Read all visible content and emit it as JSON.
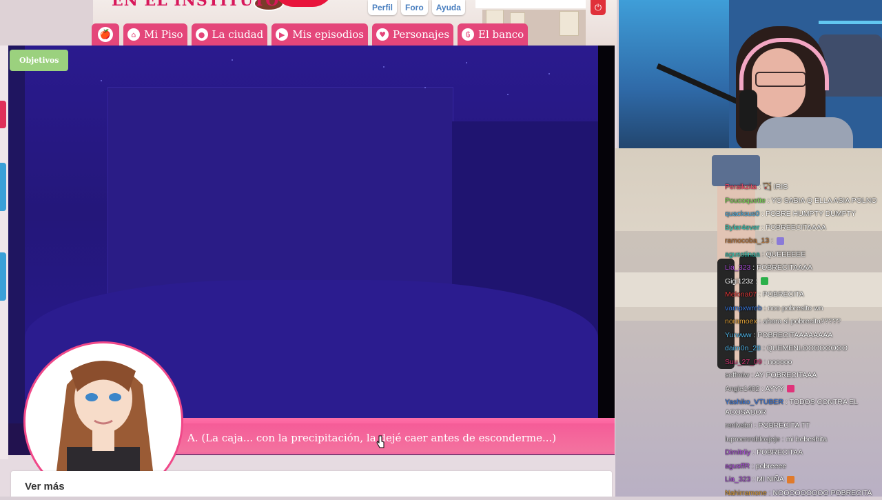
{
  "header": {
    "logo_text": "EN EL INSTITUTO",
    "top_links": [
      "Perfil",
      "Foro",
      "Ayuda"
    ],
    "power_icon": "power-icon"
  },
  "nav": {
    "tabs": [
      {
        "label": "",
        "icon": "apple-icon",
        "glyph": "🍎"
      },
      {
        "label": "Mi Piso",
        "icon": "home-icon",
        "glyph": "⌂"
      },
      {
        "label": "La ciudad",
        "icon": "map-pin-icon",
        "glyph": "●"
      },
      {
        "label": "Mis episodios",
        "icon": "play-icon",
        "glyph": "▶"
      },
      {
        "label": "Personajes",
        "icon": "heart-icon",
        "glyph": "♥"
      },
      {
        "label": "El banco",
        "icon": "bank-icon",
        "glyph": "₲"
      }
    ]
  },
  "game": {
    "objectives_label": "Objetivos",
    "dialogue_text": "A. (La caja... con la precipitación, la dejé caer antes de esconderme...)"
  },
  "footer": {
    "see_more_label": "Ver más"
  },
  "chat": {
    "messages": [
      {
        "user": "Peralkzita",
        "color": "#ff4f6e",
        "text": " : 🏹 IRIS",
        "emote": null
      },
      {
        "user": "Poucoquette",
        "color": "#7fe05a",
        "text": " : YO SABIA Q ELLA ASIA POLNO",
        "emote": null
      },
      {
        "user": "quacksus0",
        "color": "#52b6e8",
        "text": " : POBRE HUMPTY DUMPTY",
        "emote": null
      },
      {
        "user": "Byler4ever",
        "color": "#2fd5c2",
        "text": " : POBREECITAAAA",
        "emote": null
      },
      {
        "user": "ramocoba_13",
        "color": "#c27a3a",
        "text": " : ",
        "emote": "#8a7ad8"
      },
      {
        "user": "agusstinaa",
        "color": "#2fd5c2",
        "text": " : QUEEEEEE",
        "emote": null
      },
      {
        "user": "Lia_323",
        "color": "#b04fe0",
        "text": " : POBRECITAAAA",
        "emote": null
      },
      {
        "user": "Gigi123z",
        "color": "#ffffff",
        "text": " : ",
        "emote": "#2bb04a"
      },
      {
        "user": "Melona07",
        "color": "#e03b3b",
        "text": " : POBRECITA",
        "emote": null
      },
      {
        "user": "vampxwreb",
        "color": "#3b7be0",
        "text": " : noo pobresito wn",
        "emote": null
      },
      {
        "user": "noramoex",
        "color": "#e0a23b",
        "text": " : ahora si pobrecita?????",
        "emote": null
      },
      {
        "user": "Yurwww",
        "color": "#52b6e8",
        "text": " : POBRECITAAAAAAAA",
        "emote": null
      },
      {
        "user": "daim0n_28",
        "color": "#52b6e8",
        "text": " : QUEMENLOOOOOOOO",
        "emote": null
      },
      {
        "user": "Suu_27_09",
        "color": "#e03b7b",
        "text": " : nooooo",
        "emote": null
      },
      {
        "user": "soffmiw",
        "color": "#dddddd",
        "text": " : AY POBRECITAAA",
        "emote": null
      },
      {
        "user": "Angie1402",
        "color": "#dddddd",
        "text": " : AYYY ",
        "emote": "#e0337a"
      },
      {
        "user": "Yashiko_VTUBER",
        "color": "#3b7be0",
        "text": " : TODOS CONTRA EL ACOSADOR",
        "emote": null,
        "wrap": true
      },
      {
        "user": "renlvsbri",
        "color": "#dddddd",
        "text": " : POBRECITA TT",
        "emote": null
      },
      {
        "user": "luproenrobloxjeje",
        "color": "#dddddd",
        "text": " : mi bebeshita",
        "emote": null
      },
      {
        "user": "Dimitriiy",
        "color": "#b04fe0",
        "text": " : POBRECITAA",
        "emote": null
      },
      {
        "user": "agusffR",
        "color": "#b04fe0",
        "text": " : pobreeee",
        "emote": null
      },
      {
        "user": "Lia_323",
        "color": "#b04fe0",
        "text": " : MI NIÑA ",
        "emote": "#e07a2b"
      },
      {
        "user": "Nahirramone",
        "color": "#e0a23b",
        "text": " : NOOOOOOOOO POBRECITA",
        "emote": null
      }
    ]
  }
}
